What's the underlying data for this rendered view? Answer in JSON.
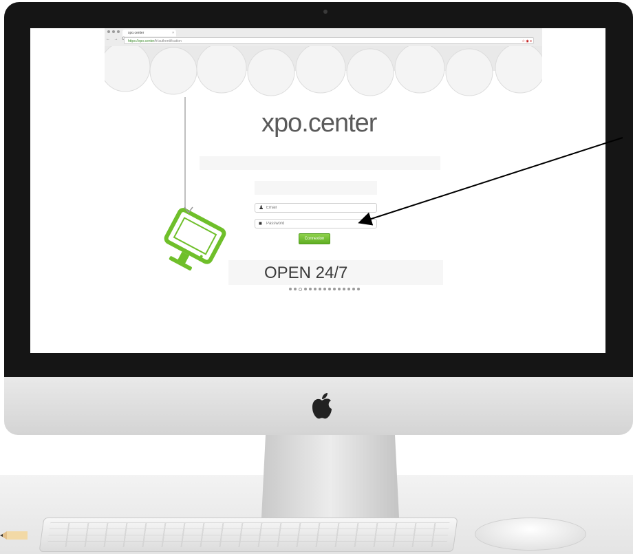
{
  "browser": {
    "tab_title": "xpo.center",
    "tab_close": "×",
    "nav": "← → C",
    "url_host": "https://xpo.center",
    "url_path": "/fr/authentification",
    "toolbar_icons": "☆ ◉ ≡"
  },
  "brand": "xpo.center",
  "login": {
    "email_placeholder": "Email",
    "password_placeholder": "Password",
    "submit_label": "Connexion"
  },
  "slogan": "OPEN 24/7",
  "carousel": {
    "count": 15,
    "active_index": 3
  },
  "colors": {
    "accent": "#6fbf2a",
    "bezel": "#151515",
    "callout": "#000000"
  },
  "icons": {
    "email": "user-icon",
    "password": "lock-icon",
    "chin": "apple-logo"
  }
}
